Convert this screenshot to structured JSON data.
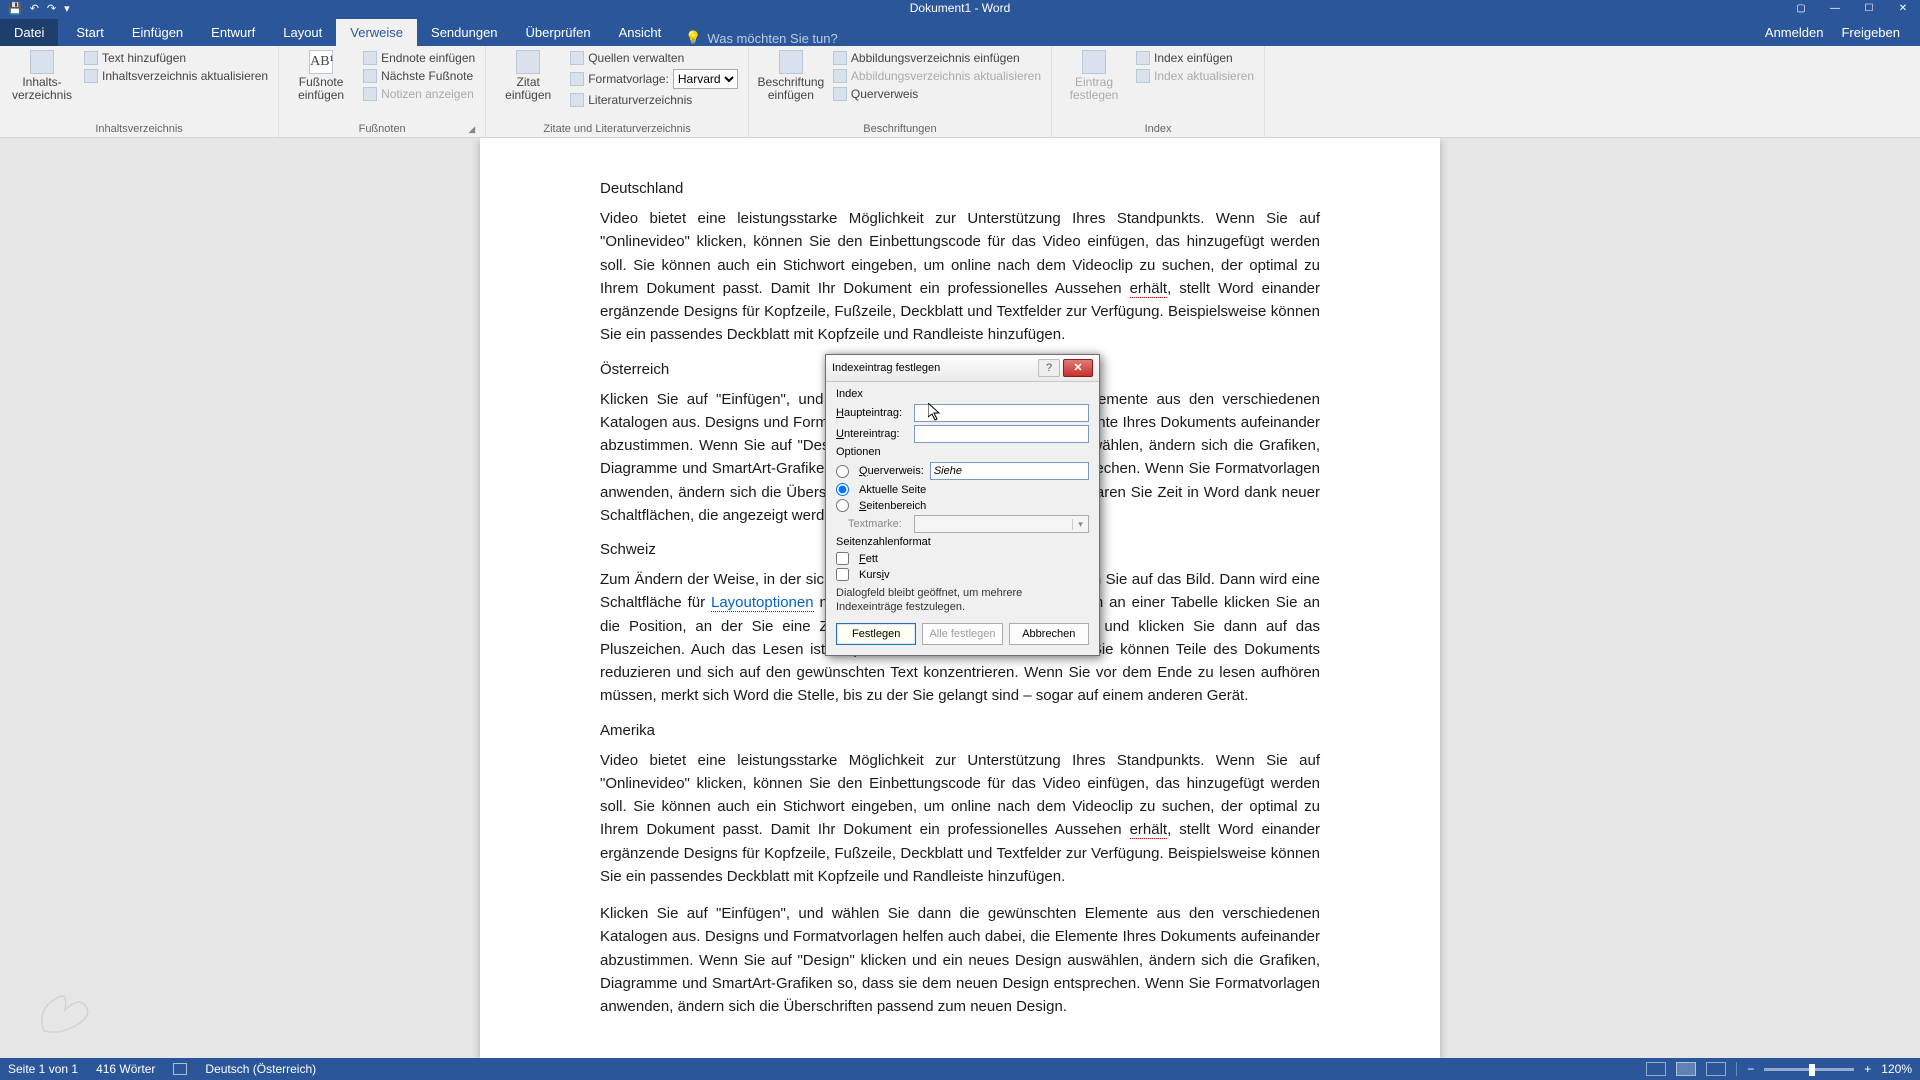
{
  "app": {
    "title": "Dokument1 - Word"
  },
  "qat": {
    "save": "💾",
    "undo": "↶",
    "redo": "↷",
    "more": "▾"
  },
  "tabs": {
    "file": "Datei",
    "start": "Start",
    "einfuegen": "Einfügen",
    "entwurf": "Entwurf",
    "layout": "Layout",
    "verweise": "Verweise",
    "sendungen": "Sendungen",
    "ueberpruefen": "Überprüfen",
    "ansicht": "Ansicht",
    "tellme": "Was möchten Sie tun?",
    "anmelden": "Anmelden",
    "freigeben": "Freigeben"
  },
  "ribbon": {
    "g1": {
      "big": "Inhalts-\nverzeichnis",
      "r1": "Text hinzufügen",
      "r2": "Inhaltsverzeichnis aktualisieren",
      "label": "Inhaltsverzeichnis"
    },
    "g2": {
      "big": "Fußnote\neinfügen",
      "r1": "Endnote einfügen",
      "r2": "Nächste Fußnote",
      "r3": "Notizen anzeigen",
      "label": "Fußnoten"
    },
    "g3": {
      "big": "Zitat\neinfügen",
      "r1": "Quellen verwalten",
      "r2_label": "Formatvorlage:",
      "r2_value": "Harvard",
      "r3": "Literaturverzeichnis",
      "label": "Zitate und Literaturverzeichnis"
    },
    "g4": {
      "big": "Beschriftung\neinfügen",
      "r1": "Abbildungsverzeichnis einfügen",
      "r2": "Abbildungsverzeichnis aktualisieren",
      "r3": "Querverweis",
      "label": "Beschriftungen"
    },
    "g5": {
      "big": "Eintrag\nfestlegen",
      "r1": "Index einfügen",
      "r2": "Index aktualisieren",
      "label": "Index"
    }
  },
  "doc": {
    "h1": "Deutschland",
    "p1": "Video bietet eine leistungsstarke Möglichkeit zur Unterstützung Ihres Standpunkts. Wenn Sie auf \"Onlinevideo\" klicken, können Sie den Einbettungscode für das Video einfügen, das hinzugefügt werden soll. Sie können auch ein Stichwort eingeben, um online nach dem Videoclip zu suchen, der optimal zu Ihrem Dokument passt. Damit Ihr Dokument ein professionelles Aussehen ",
    "p1_err": "erhält",
    "p1b": ", stellt Word einander ergänzende Designs für Kopfzeile, Fußzeile, Deckblatt und Textfelder zur Verfügung. Beispielsweise können Sie ein passendes Deckblatt mit Kopfzeile und Randleiste hinzufügen.",
    "h2": "Österreich",
    "p2": "Klicken Sie auf \"Einfügen\", und wählen Sie dann die gewünschten Elemente aus den verschiedenen Katalogen aus. Designs und Formatvorlagen helfen auch dabei, die Elemente Ihres Dokuments aufeinander abzustimmen. Wenn Sie auf \"Design\" klicken und ein neues Design auswählen, ändern sich die Grafiken, Diagramme und SmartArt-Grafiken so, dass sie dem neuen Design entsprechen. Wenn Sie Formatvorlagen anwenden, ändern sich die Überschriften passend zum neuen Design. Sparen Sie Zeit in Word dank neuer Schaltflächen, die angezeigt werden, wo Sie sie benötigen.",
    "h3": "Schweiz",
    "p3a": "Zum Ändern der Weise, in der sich ein Bild in Ihr Dokument einfügt, klicken Sie auf das Bild. Dann wird eine Schaltfläche für ",
    "p3_link": "Layoutoptionen",
    "p3b": " neben dem Bild angezeigt. Beim Arbeiten an einer Tabelle klicken Sie an die Position, an der Sie eine Zeile oder Spalte hinzufügen möchten, und klicken Sie dann auf das Pluszeichen. Auch das Lesen ist bequemer in der neuen Leseansicht. Sie können Teile des Dokuments reduzieren und sich auf den gewünschten Text konzentrieren. Wenn Sie vor dem Ende zu lesen aufhören müssen, merkt sich Word die Stelle, bis zu der Sie gelangt sind – sogar auf einem anderen Gerät.",
    "h4": "Amerika",
    "p4": "Video bietet eine leistungsstarke Möglichkeit zur Unterstützung Ihres Standpunkts. Wenn Sie auf \"Onlinevideo\" klicken, können Sie den Einbettungscode für das Video einfügen, das hinzugefügt werden soll. Sie können auch ein Stichwort eingeben, um online nach dem Videoclip zu suchen, der optimal zu Ihrem Dokument passt. Damit Ihr Dokument ein professionelles Aussehen ",
    "p4_err": "erhält",
    "p4b": ", stellt Word einander ergänzende Designs für Kopfzeile, Fußzeile, Deckblatt und Textfelder zur Verfügung. Beispielsweise können Sie ein passendes Deckblatt mit Kopfzeile und Randleiste hinzufügen.",
    "p5": "Klicken Sie auf \"Einfügen\", und wählen Sie dann die gewünschten Elemente aus den verschiedenen Katalogen aus. Designs und Formatvorlagen helfen auch dabei, die Elemente Ihres Dokuments aufeinander abzustimmen. Wenn Sie auf \"Design\" klicken und ein neues Design auswählen, ändern sich die Grafiken, Diagramme und SmartArt-Grafiken so, dass sie dem neuen Design entsprechen. Wenn Sie Formatvorlagen anwenden, ändern sich die Überschriften passend zum neuen Design."
  },
  "dialog": {
    "title": "Indexeintrag festlegen",
    "sec_index": "Index",
    "haupteintrag": "Haupteintrag:",
    "untereintrag": "Untereintrag:",
    "sec_optionen": "Optionen",
    "querverweis": "Querverweis:",
    "querverweis_val": "Siehe",
    "aktseite": "Aktuelle Seite",
    "seitenbereich": "Seitenbereich",
    "textmarke": "Textmarke:",
    "sec_format": "Seitenzahlenformat",
    "fett": "Fett",
    "kursiv": "Kursiv",
    "note": "Dialogfeld bleibt geöffnet, um mehrere Indexeinträge festzulegen.",
    "btn_ok": "Festlegen",
    "btn_all": "Alle festlegen",
    "btn_cancel": "Abbrechen"
  },
  "status": {
    "page": "Seite 1 von 1",
    "words": "416 Wörter",
    "lang": "Deutsch (Österreich)",
    "zoom": "120%"
  }
}
